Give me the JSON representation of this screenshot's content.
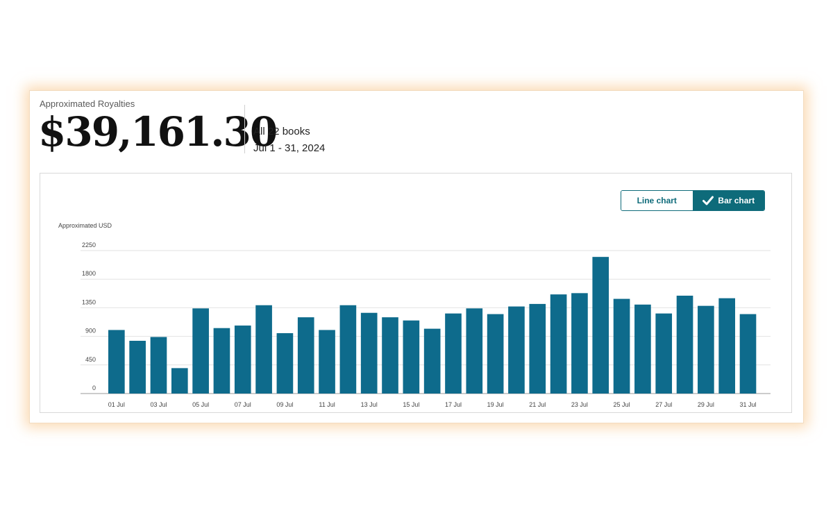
{
  "summary": {
    "label": "Approximated Royalties",
    "amount": "$39,161.30",
    "scope": "All 22 books",
    "date_range": "Jul 1 - 31, 2024"
  },
  "toggle": {
    "line_label": "Line chart",
    "bar_label": "Bar chart",
    "selected": "bar"
  },
  "colors": {
    "bar": "#0e6b8c",
    "accent": "#0e6b7a"
  },
  "chart_data": {
    "type": "bar",
    "ylabel": "Approximated USD",
    "ylim": [
      0,
      2250
    ],
    "yticks": [
      0,
      450,
      900,
      1350,
      1800,
      2250
    ],
    "grid": true,
    "categories": [
      "01 Jul",
      "02 Jul",
      "03 Jul",
      "04 Jul",
      "05 Jul",
      "06 Jul",
      "07 Jul",
      "08 Jul",
      "09 Jul",
      "10 Jul",
      "11 Jul",
      "12 Jul",
      "13 Jul",
      "14 Jul",
      "15 Jul",
      "16 Jul",
      "17 Jul",
      "18 Jul",
      "19 Jul",
      "20 Jul",
      "21 Jul",
      "22 Jul",
      "23 Jul",
      "24 Jul",
      "25 Jul",
      "26 Jul",
      "27 Jul",
      "28 Jul",
      "29 Jul",
      "30 Jul",
      "31 Jul"
    ],
    "shown_tick_labels": [
      "01 Jul",
      "03 Jul",
      "05 Jul",
      "07 Jul",
      "09 Jul",
      "11 Jul",
      "13 Jul",
      "15 Jul",
      "17 Jul",
      "19 Jul",
      "21 Jul",
      "23 Jul",
      "25 Jul",
      "27 Jul",
      "29 Jul",
      "31 Jul"
    ],
    "values": [
      1000,
      830,
      890,
      400,
      1340,
      1030,
      1070,
      1390,
      950,
      1200,
      1000,
      1390,
      1270,
      1200,
      1150,
      1020,
      1260,
      1340,
      1250,
      1370,
      1410,
      1560,
      1580,
      2150,
      1490,
      1400,
      1260,
      1540,
      1380,
      1500,
      1250
    ]
  }
}
